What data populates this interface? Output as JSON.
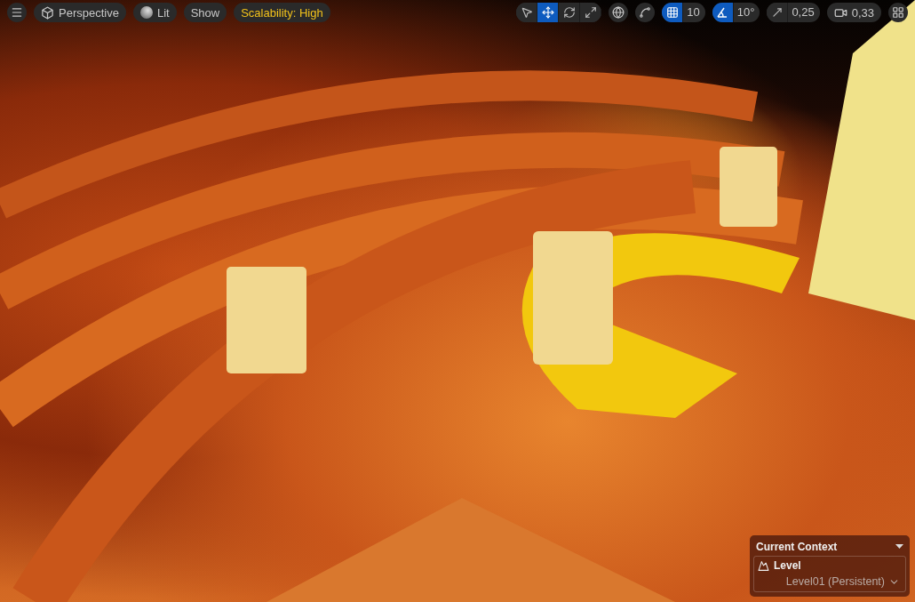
{
  "viewport_toolbar": {
    "menu": {
      "kind": "menu"
    },
    "left_buttons": [
      {
        "kind": "view",
        "label": "Perspective"
      },
      {
        "kind": "lit",
        "label": "Lit"
      },
      {
        "kind": "plain",
        "label": "Show"
      },
      {
        "kind": "scalability",
        "label": "Scalability: High"
      }
    ],
    "transform_tools": [
      {
        "kind": "select",
        "selected": false
      },
      {
        "kind": "translate",
        "selected": true
      },
      {
        "kind": "rotate",
        "selected": false
      },
      {
        "kind": "scale",
        "selected": false
      }
    ],
    "snaps": [
      {
        "kind": "grid",
        "on": true,
        "value": "10"
      },
      {
        "kind": "rotation",
        "on": true,
        "value": "10°"
      },
      {
        "kind": "scale",
        "on": false,
        "value": "0,25"
      }
    ],
    "camera_speed": "0,33"
  },
  "context_panel": {
    "title": "Current Context",
    "section": "Level",
    "value": "Level01 (Persistent)"
  }
}
